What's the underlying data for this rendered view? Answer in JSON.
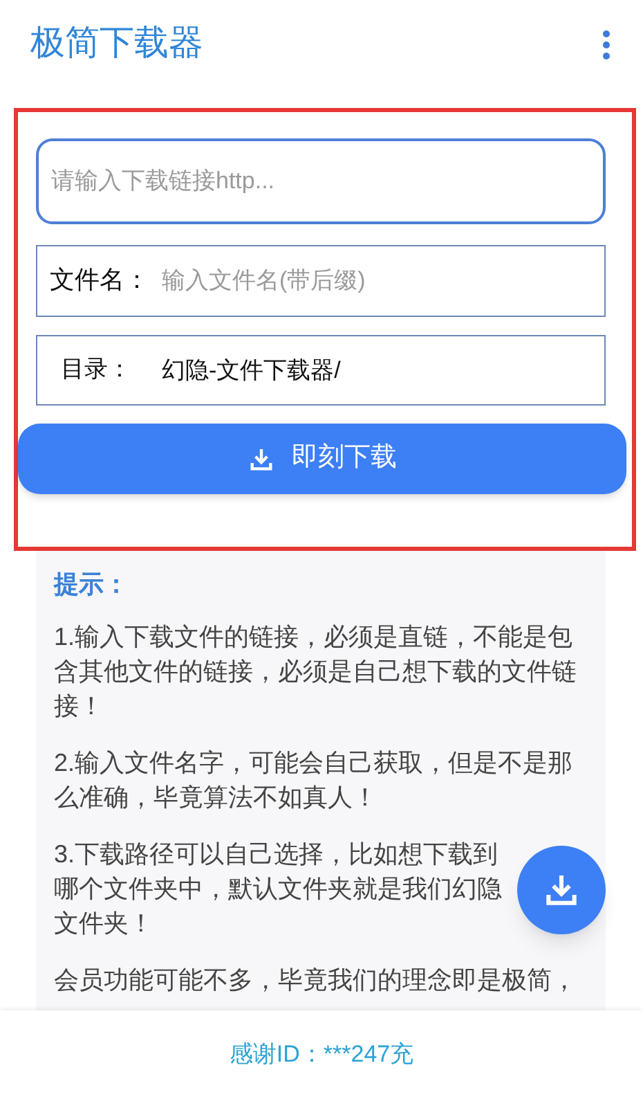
{
  "app_bar": {
    "title": "极简下载器"
  },
  "form": {
    "url_field": {
      "placeholder": "请输入下载链接http..."
    },
    "filename_field": {
      "label": "文件名：",
      "placeholder": "输入文件名(带后缀)"
    },
    "directory_field": {
      "label": "目录：",
      "value": "幻隐-文件下载器/"
    },
    "download_button": {
      "label": "即刻下载"
    }
  },
  "tips": {
    "title": "提示：",
    "paragraphs": [
      "1.输入下载文件的链接，必须是直链，不能是包含其他文件的链接，必须是自己想下载的文件链接！",
      "2.输入文件名字，可能会自己获取，但是不是那么准确，毕竟算法不如真人！",
      "3.下载路径可以自己选择，比如想下载到哪个文件夹中，默认文件夹就是我们幻隐文件夹！",
      "会员功能可能不多，毕竟我们的理念即是极简，"
    ]
  },
  "footer": {
    "text": "感谢ID：***247充"
  }
}
